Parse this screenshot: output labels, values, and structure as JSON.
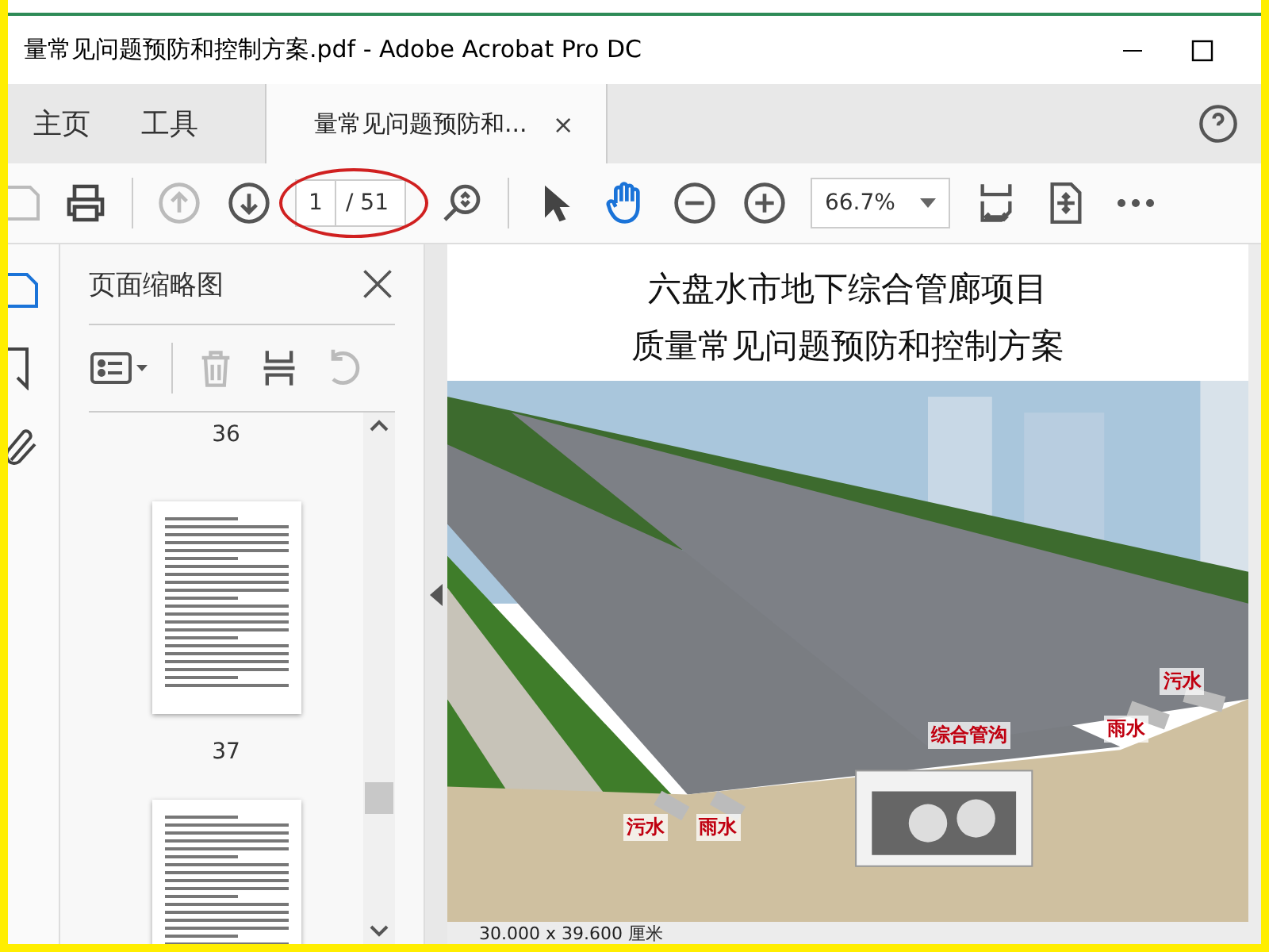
{
  "window": {
    "title": "量常见问题预防和控制方案.pdf - Adobe Acrobat Pro DC"
  },
  "nav_tabs": [
    {
      "label": "主页",
      "selected": false
    },
    {
      "label": "工具",
      "selected": false
    }
  ],
  "document_tab": {
    "label": "量常见问题预防和...",
    "close": "×",
    "selected": true
  },
  "toolbar": {
    "page_input": "1",
    "page_total": "/ 51",
    "zoom": "66.7%"
  },
  "thumbnail_panel": {
    "title": "页面缩略图",
    "pages": [
      {
        "number": "36"
      },
      {
        "number": "37"
      }
    ]
  },
  "document": {
    "title_lines": [
      "六盘水市地下综合管廊项目",
      "质量常见问题预防和控制方案"
    ],
    "illustration_labels": [
      {
        "text": "污水"
      },
      {
        "text": "雨水"
      },
      {
        "text": "综合管沟"
      },
      {
        "text": "雨水"
      },
      {
        "text": "污水"
      }
    ]
  },
  "status_bar": {
    "page_size": "30.000 x 39.600 厘米"
  }
}
